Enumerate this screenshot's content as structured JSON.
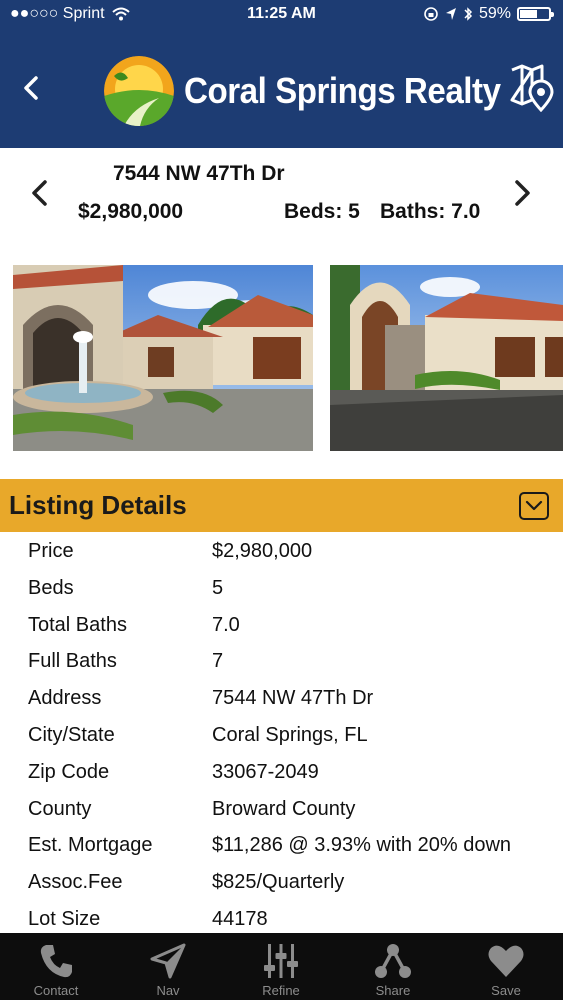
{
  "status_bar": {
    "carrier": "●●○○○ Sprint",
    "time": "11:25 AM",
    "battery": "59%",
    "battery_level": 0.59
  },
  "header": {
    "brand": "Coral Springs Realty",
    "back_icon": "chevron-left-icon",
    "map_icon": "map-pin-icon",
    "bg_color": "#1d3c73"
  },
  "property": {
    "address": "7544 NW 47Th Dr",
    "price": "$2,980,000",
    "beds": "Beds: 5",
    "baths": "Baths: 7.0"
  },
  "details": {
    "title": "Listing Details",
    "accent_color": "#e8a82a",
    "rows": [
      {
        "label": "Price",
        "value": "$2,980,000"
      },
      {
        "label": "Beds",
        "value": "5"
      },
      {
        "label": "Total Baths",
        "value": "7.0"
      },
      {
        "label": "Full Baths",
        "value": "7"
      },
      {
        "label": "Address",
        "value": "7544 NW 47Th Dr"
      },
      {
        "label": "City/State",
        "value": "Coral Springs, FL"
      },
      {
        "label": "Zip Code",
        "value": "33067-2049"
      },
      {
        "label": "County",
        "value": "Broward County"
      },
      {
        "label": "Est. Mortgage",
        "value": "$11,286 @ 3.93% with 20% down"
      },
      {
        "label": "Assoc.Fee",
        "value": "$825/Quarterly"
      },
      {
        "label": "Lot Size",
        "value": "44178"
      }
    ]
  },
  "tabs": [
    {
      "label": "Contact",
      "icon": "phone-icon"
    },
    {
      "label": "Nav",
      "icon": "navigation-arrow-icon"
    },
    {
      "label": "Refine",
      "icon": "sliders-icon"
    },
    {
      "label": "Share",
      "icon": "share-icon"
    },
    {
      "label": "Save",
      "icon": "heart-icon"
    }
  ]
}
